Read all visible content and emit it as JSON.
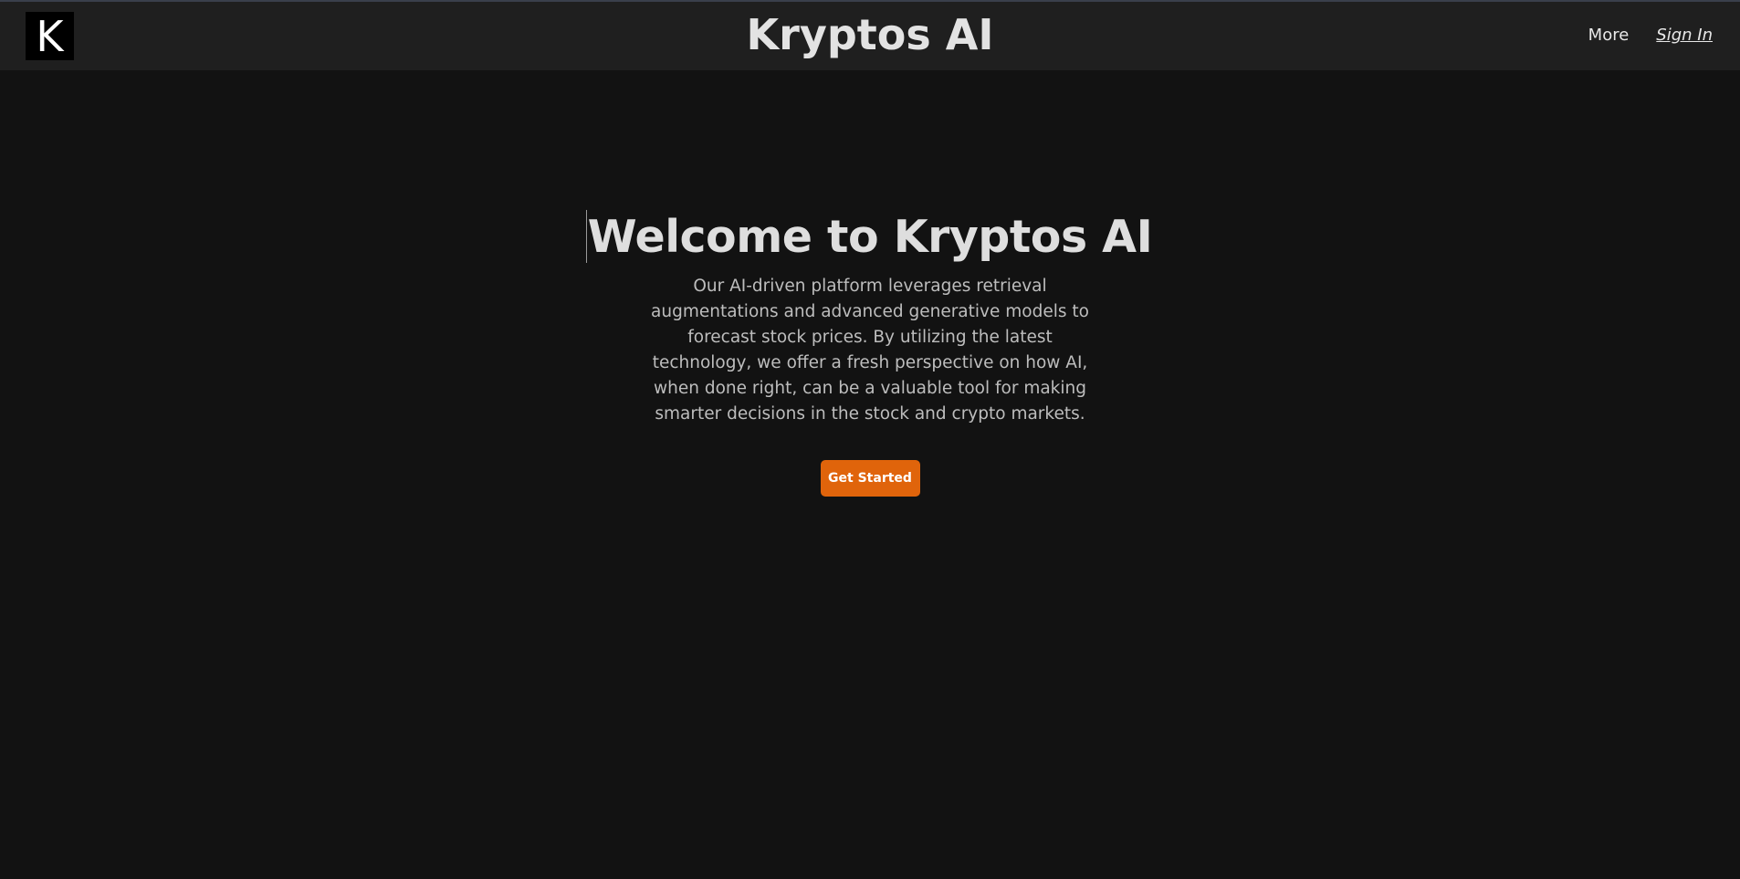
{
  "header": {
    "logo_letter": "K",
    "title": "Kryptos AI",
    "nav": {
      "more_label": "More",
      "signin_label": "Sign In"
    }
  },
  "hero": {
    "title": "Welcome to Kryptos AI",
    "description": "Our AI-driven platform leverages retrieval augmentations and advanced generative models to forecast stock prices. By utilizing the latest technology, we offer a fresh perspective on how AI, when done right, can be a valuable tool for making smarter decisions in the stock and crypto markets.",
    "cta_label": "Get Started"
  },
  "colors": {
    "background": "#121212",
    "header_background": "#1f1f1f",
    "accent": "#e0640b"
  }
}
